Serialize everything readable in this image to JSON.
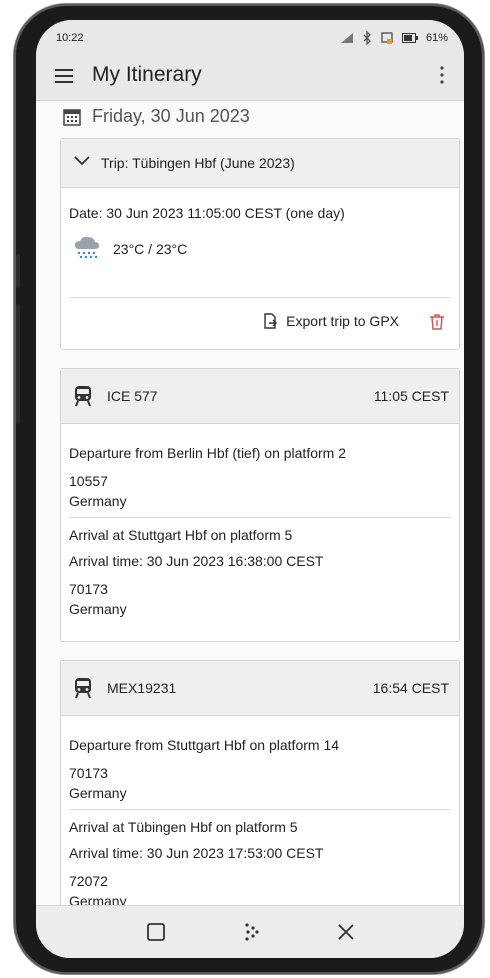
{
  "status": {
    "time": "10:22",
    "battery": "61%"
  },
  "app": {
    "title": "My Itinerary"
  },
  "day": {
    "label": "Friday, 30 Jun 2023"
  },
  "trip": {
    "title": "Trip: Tübingen Hbf (June 2023)",
    "date": "Date: 30 Jun 2023 11:05:00 CEST (one day)",
    "weather": "23°C / 23°C",
    "export_label": "Export trip to GPX"
  },
  "legs": [
    {
      "train": "ICE 577",
      "time": "11:05 CEST",
      "departure": "Departure from Berlin Hbf (tief) on platform 2",
      "departure_postcode": "10557",
      "departure_country": "Germany",
      "arrival": "Arrival at Stuttgart Hbf on platform 5",
      "arrival_time": "Arrival time: 30 Jun 2023 16:38:00 CEST",
      "arrival_postcode": "70173",
      "arrival_country": "Germany"
    },
    {
      "train": "MEX19231",
      "time": "16:54 CEST",
      "departure": "Departure from Stuttgart Hbf on platform 14",
      "departure_postcode": "70173",
      "departure_country": "Germany",
      "arrival": "Arrival at Tübingen Hbf on platform 5",
      "arrival_time": "Arrival time: 30 Jun 2023 17:53:00 CEST",
      "arrival_postcode": "72072",
      "arrival_country": "Germany"
    }
  ],
  "icons": {
    "menu": "hamburger-menu-icon",
    "more": "more-vert-icon",
    "calendar": "calendar-icon",
    "collapse": "chevron-down-icon",
    "weather": "rain-cloud-icon",
    "export": "export-file-icon",
    "delete": "trash-icon",
    "train": "train-icon"
  },
  "colors": {
    "accent_delete": "#d9534f",
    "bar": "#e8e8e8"
  }
}
